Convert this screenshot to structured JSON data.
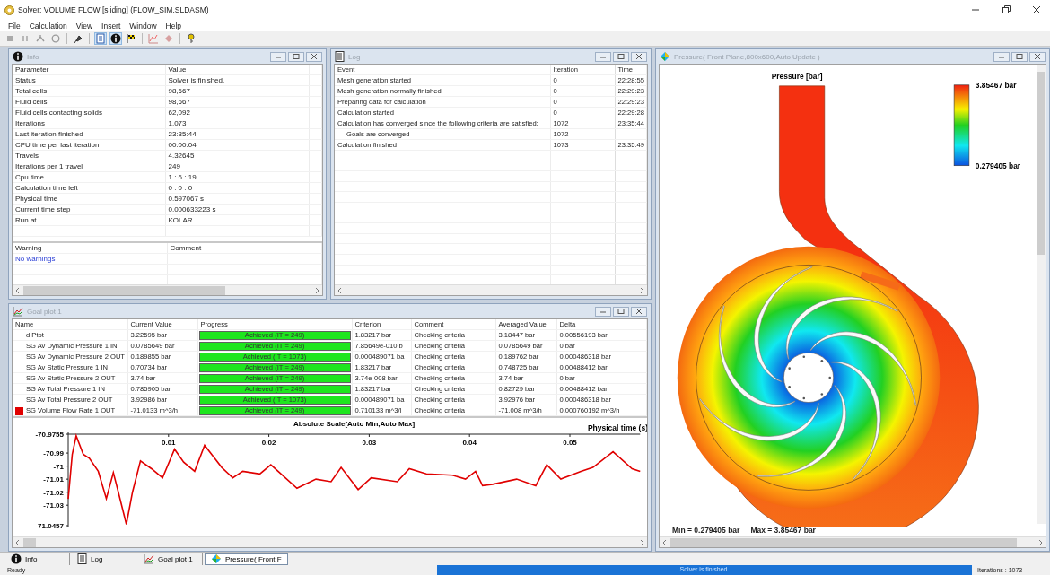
{
  "window": {
    "title": "Solver: VOLUME FLOW [sliding] (FLOW_SIM.SLDASM)"
  },
  "menu": [
    "File",
    "Calculation",
    "View",
    "Insert",
    "Window",
    "Help"
  ],
  "info_window": {
    "title": "Info",
    "columns": [
      "Parameter",
      "Value"
    ],
    "rows": [
      [
        "Status",
        "Solver is finished."
      ],
      [
        "Total cells",
        "98,667"
      ],
      [
        "Fluid cells",
        "98,667"
      ],
      [
        "Fluid cells contacting solids",
        "62,092"
      ],
      [
        "Iterations",
        "1,073"
      ],
      [
        "Last iteration finished",
        "23:35:44"
      ],
      [
        "CPU time per last iteration",
        "00:00:04"
      ],
      [
        "Travels",
        "4.32645"
      ],
      [
        "Iterations per 1 travel",
        "249"
      ],
      [
        "Cpu time",
        "1 : 6 : 19"
      ],
      [
        "Calculation time left",
        "0 : 0 : 0"
      ],
      [
        "Physical time",
        "0.597067 s"
      ],
      [
        "Current time step",
        "0.000633223 s"
      ],
      [
        "Run at",
        "KOLAR"
      ]
    ],
    "warnings": {
      "columns": [
        "Warning",
        "Comment"
      ],
      "items": [
        "No warnings"
      ]
    }
  },
  "log_window": {
    "title": "Log",
    "columns": [
      "Event",
      "Iteration",
      "Time"
    ],
    "rows": [
      {
        "event": "Mesh generation started",
        "iteration": "0",
        "time": "22:28:55"
      },
      {
        "event": "Mesh generation normally finished",
        "iteration": "0",
        "time": "22:29:23"
      },
      {
        "event": "Preparing data for calculation",
        "iteration": "0",
        "time": "22:29:23"
      },
      {
        "event": "Calculation started",
        "iteration": "0",
        "time": "22:29:28"
      },
      {
        "event": "Calculation has converged since the following criteria are satisfied:",
        "iteration": "1072",
        "time": "23:35:44",
        "children": [
          {
            "event": "Goals are converged",
            "iteration": "1072"
          }
        ]
      },
      {
        "event": "Calculation finished",
        "iteration": "1073",
        "time": "23:35:49"
      }
    ]
  },
  "goal_window": {
    "title": "Goal plot 1",
    "columns": [
      "Name",
      "Current Value",
      "Progress",
      "Criterion",
      "Comment",
      "Averaged Value",
      "Delta"
    ],
    "rows": [
      {
        "name": "d Ptot",
        "current": "3.22595 bar",
        "level": 1,
        "progress": "Achieved (IT = 249)",
        "criterion": "1.83217 bar",
        "comment": "Checking criteria",
        "averaged": "3.18447 bar",
        "delta": "0.00556193 bar"
      },
      {
        "name": "SG Av Dynamic Pressure 1 IN",
        "current": "0.0785649 bar",
        "level": 1,
        "progress": "Achieved (IT = 249)",
        "criterion": "7.85649e-010 b",
        "comment": "Checking criteria",
        "averaged": "0.0785649 bar",
        "delta": "0 bar"
      },
      {
        "name": "SG Av Dynamic Pressure 2 OUT",
        "current": "0.189855 bar",
        "level": 1,
        "progress": "Achieved (IT = 1073)",
        "criterion": "0.000489071 ba",
        "comment": "Checking criteria",
        "averaged": "0.189762 bar",
        "delta": "0.000486318 bar"
      },
      {
        "name": "SG Av Static Pressure 1 IN",
        "current": "0.70734 bar",
        "level": 1,
        "progress": "Achieved (IT = 249)",
        "criterion": "1.83217 bar",
        "comment": "Checking criteria",
        "averaged": "0.748725 bar",
        "delta": "0.00488412 bar"
      },
      {
        "name": "SG Av Static Pressure 2 OUT",
        "current": "3.74 bar",
        "level": 1,
        "progress": "Achieved (IT = 249)",
        "criterion": "3.74e-008 bar",
        "comment": "Checking criteria",
        "averaged": "3.74 bar",
        "delta": "0 bar"
      },
      {
        "name": "SG Av Total Pressure 1 IN",
        "current": "0.785905 bar",
        "level": 1,
        "progress": "Achieved (IT = 249)",
        "criterion": "1.83217 bar",
        "comment": "Checking criteria",
        "averaged": "0.82729 bar",
        "delta": "0.00488412 bar"
      },
      {
        "name": "SG Av Total Pressure 2 OUT",
        "current": "3.92986 bar",
        "level": 1,
        "progress": "Achieved (IT = 1073)",
        "criterion": "0.000489071 ba",
        "comment": "Checking criteria",
        "averaged": "3.92976 bar",
        "delta": "0.000486318 bar"
      },
      {
        "name": "SG Volume Flow Rate 1 OUT",
        "current": "-71.0133 m^3/h",
        "level": 1,
        "progress": "Achieved (IT = 249)",
        "criterion": "0.710133 m^3/l",
        "comment": "Checking criteria",
        "averaged": "-71.008 m^3/h",
        "delta": "0.000760192 m^3/h",
        "color": "#e00000"
      }
    ],
    "chart_data": {
      "type": "line",
      "title": "Absolute Scale[Auto Min,Auto Max]",
      "xlabel": "Physical time (s)",
      "x": [
        0,
        0.0004,
        0.0008,
        0.0015,
        0.0021,
        0.003,
        0.0038,
        0.0045,
        0.005,
        0.0058,
        0.0064,
        0.0072,
        0.0083,
        0.0094,
        0.0106,
        0.0115,
        0.0126,
        0.0136,
        0.0153,
        0.0164,
        0.0174,
        0.0191,
        0.0202,
        0.0228,
        0.0247,
        0.0262,
        0.0272,
        0.0289,
        0.0302,
        0.0328,
        0.034,
        0.0357,
        0.0383,
        0.0396,
        0.0406,
        0.0413,
        0.0423,
        0.0447,
        0.0466,
        0.0477,
        0.0491,
        0.0511,
        0.0523,
        0.0543,
        0.0562,
        0.057
      ],
      "series": [
        {
          "color": "#e00000",
          "values": [
            -71.0251,
            -70.991,
            -70.9768,
            -70.991,
            -70.994,
            -71.004,
            -71.025,
            -71.005,
            -71.02,
            -71.0447,
            -71.02,
            -70.996,
            -71.002,
            -71.009,
            -70.987,
            -70.997,
            -71.004,
            -70.984,
            -71.001,
            -71.009,
            -71.004,
            -71.006,
            -70.999,
            -71.017,
            -71.01,
            -71.012,
            -71.001,
            -71.018,
            -71.009,
            -71.012,
            -71.002,
            -71.006,
            -71.007,
            -71.01,
            -71.004,
            -71.015,
            -71.014,
            -71.01,
            -71.015,
            -70.999,
            -71.01,
            -71.004,
            -71.001,
            -70.989,
            -71.002,
            -71.004
          ]
        }
      ],
      "xlim": [
        0,
        0.057
      ],
      "ylim": [
        -71.0457,
        -70.9755
      ],
      "xticks": [
        0.01,
        0.02,
        0.03,
        0.04,
        0.05
      ],
      "yticks": [
        -70.9755,
        -70.99,
        -71,
        -71.01,
        -71.02,
        -71.03,
        -71.0457
      ]
    }
  },
  "pressure_window": {
    "title": "Pressure( Front Plane,800x600,Auto Update )",
    "plot_title": "Pressure [bar]",
    "legend": {
      "max": "3.85467 bar",
      "min": "0.279405 bar"
    },
    "min_text": "Min = 0.279405 bar",
    "max_text": "Max = 3.85467 bar"
  },
  "tabs": [
    {
      "kind": "info",
      "label": "Info",
      "selected": false
    },
    {
      "kind": "log",
      "label": "Log",
      "selected": false
    },
    {
      "kind": "goal",
      "label": "Goal plot 1",
      "selected": false
    },
    {
      "kind": "plot",
      "label": "Pressure( Front F",
      "selected": true
    }
  ],
  "status_bar": {
    "message": "Ready",
    "progress": {
      "label": "Solver is finished.",
      "level": 1
    },
    "iterations": "Iterations : 1073"
  }
}
